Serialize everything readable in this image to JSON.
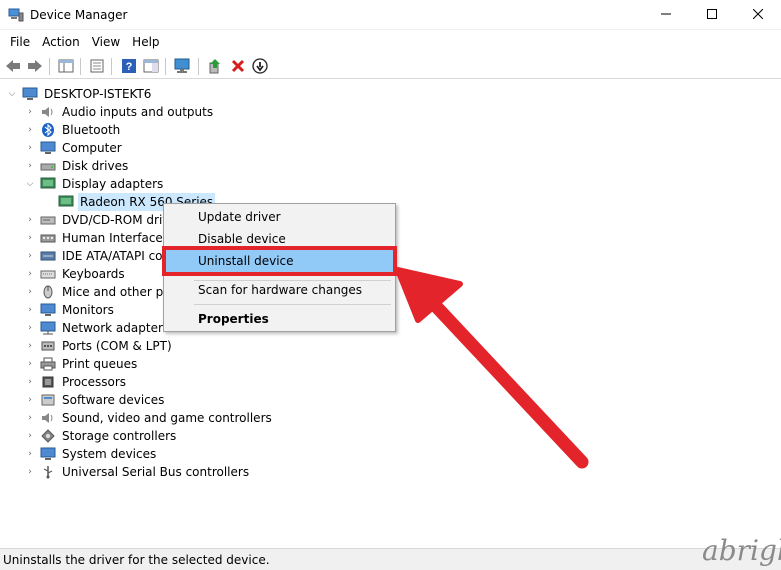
{
  "window": {
    "title": "Device Manager",
    "app_icon": "device-manager-icon",
    "controls": {
      "minimize": "minimize-icon",
      "maximize": "maximize-icon",
      "close": "close-icon"
    }
  },
  "menubar": {
    "items": [
      {
        "label": "File"
      },
      {
        "label": "Action"
      },
      {
        "label": "View"
      },
      {
        "label": "Help"
      }
    ]
  },
  "toolbar": {
    "icons": [
      "back-icon",
      "forward-icon",
      "show-hide-tree-icon",
      "properties-icon",
      "help-icon",
      "action-pane-icon",
      "scan-hardware-icon",
      "update-driver-icon",
      "uninstall-icon",
      "disable-icon"
    ]
  },
  "tree": {
    "root": "DESKTOP-ISTEKT6",
    "items": [
      {
        "label": "Audio inputs and outputs",
        "icon": "speaker-icon"
      },
      {
        "label": "Bluetooth",
        "icon": "bluetooth-icon"
      },
      {
        "label": "Computer",
        "icon": "computer-icon"
      },
      {
        "label": "Disk drives",
        "icon": "disk-drive-icon"
      },
      {
        "label": "Display adapters",
        "icon": "display-adapter-icon",
        "expanded": true
      },
      {
        "label": "Radeon RX 560 Series",
        "icon": "display-adapter-icon",
        "child": true,
        "selected": true
      },
      {
        "label": "DVD/CD-ROM driv",
        "icon": "dvd-icon"
      },
      {
        "label": "Human Interface D",
        "icon": "hid-icon"
      },
      {
        "label": "IDE ATA/ATAPI con",
        "icon": "ide-controller-icon"
      },
      {
        "label": "Keyboards",
        "icon": "keyboard-icon"
      },
      {
        "label": "Mice and other poi",
        "icon": "mouse-icon"
      },
      {
        "label": "Monitors",
        "icon": "monitor-icon"
      },
      {
        "label": "Network adapters",
        "icon": "network-adapter-icon"
      },
      {
        "label": "Ports (COM & LPT)",
        "icon": "port-icon"
      },
      {
        "label": "Print queues",
        "icon": "printer-icon"
      },
      {
        "label": "Processors",
        "icon": "processor-icon"
      },
      {
        "label": "Software devices",
        "icon": "software-device-icon"
      },
      {
        "label": "Sound, video and game controllers",
        "icon": "sound-icon"
      },
      {
        "label": "Storage controllers",
        "icon": "storage-controller-icon"
      },
      {
        "label": "System devices",
        "icon": "system-device-icon"
      },
      {
        "label": "Universal Serial Bus controllers",
        "icon": "usb-icon"
      }
    ]
  },
  "context_menu": {
    "items": [
      {
        "label": "Update driver"
      },
      {
        "label": "Disable device"
      },
      {
        "label": "Uninstall device",
        "highlighted": true
      },
      {
        "label": "Scan for hardware changes"
      },
      {
        "label": "Properties",
        "bold": true
      }
    ]
  },
  "statusbar": {
    "text": "Uninstalls the driver for the selected device."
  },
  "watermark": {
    "text": "abrigh"
  },
  "colors": {
    "highlight": "#91c9f7",
    "annotation_red": "#e3242b",
    "selection": "#cce8ff"
  }
}
